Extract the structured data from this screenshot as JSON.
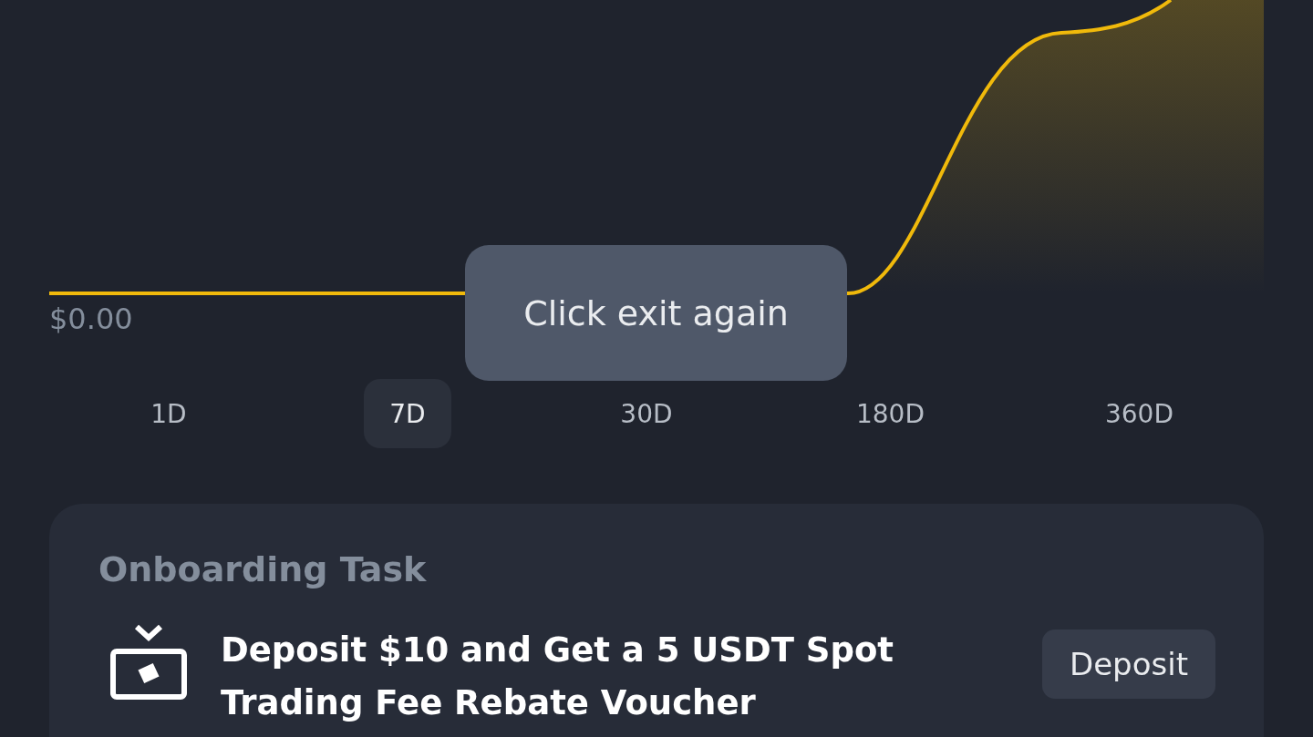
{
  "chart": {
    "baseline_label": "$0.00"
  },
  "toast": {
    "text": "Click exit again"
  },
  "period_tabs": [
    {
      "label": "1D",
      "selected": false
    },
    {
      "label": "7D",
      "selected": true
    },
    {
      "label": "30D",
      "selected": false
    },
    {
      "label": "180D",
      "selected": false
    },
    {
      "label": "360D",
      "selected": false
    }
  ],
  "onboarding_card": {
    "title": "Onboarding Task",
    "task": {
      "text": "Deposit $10 and Get a 5 USDT Spot Trading Fee Rebate Voucher",
      "button": "Deposit"
    }
  }
}
